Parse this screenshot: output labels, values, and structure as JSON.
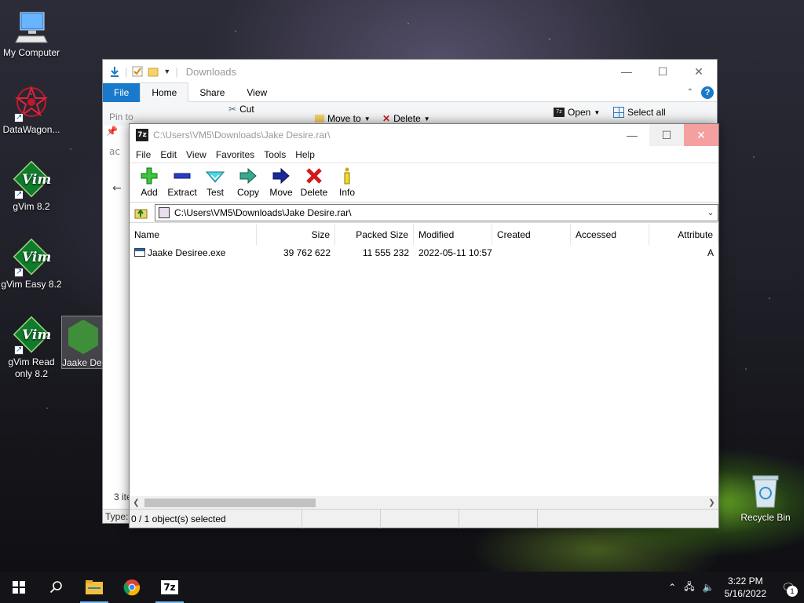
{
  "desktop": {
    "icons": [
      {
        "label": "My Computer"
      },
      {
        "label": "DataWagon..."
      },
      {
        "label": "gVim 8.2"
      },
      {
        "label": "gVim Easy 8.2"
      },
      {
        "label": "gVim Read only 8.2"
      },
      {
        "label": "Jaake Des"
      },
      {
        "label": "Recycle Bin"
      }
    ],
    "vim_mark": "Vim"
  },
  "explorer": {
    "title": "Downloads",
    "tabs": [
      "File",
      "Home",
      "Share",
      "View"
    ],
    "ribbon": {
      "cut": "Cut",
      "move_to": "Move to",
      "delete": "Delete",
      "open": "Open",
      "select_all": "Select all",
      "pin": "Pin to"
    },
    "pin_overflow": "ac",
    "help": "?",
    "items_count": "3 ite",
    "type_label": "Type:"
  },
  "sevenzip": {
    "title": "C:\\Users\\VM5\\Downloads\\Jake Desire.rar\\",
    "logo": "7z",
    "menu": [
      "File",
      "Edit",
      "View",
      "Favorites",
      "Tools",
      "Help"
    ],
    "toolbar": {
      "add": "Add",
      "extract": "Extract",
      "test": "Test",
      "copy": "Copy",
      "move": "Move",
      "delete": "Delete",
      "info": "Info"
    },
    "address": "C:\\Users\\VM5\\Downloads\\Jake Desire.rar\\",
    "columns": {
      "name": "Name",
      "size": "Size",
      "packed": "Packed Size",
      "modified": "Modified",
      "created": "Created",
      "accessed": "Accessed",
      "attributes": "Attribute"
    },
    "files": [
      {
        "name": "Jaake Desiree.exe",
        "size": "39 762 622",
        "packed": "11 555 232",
        "modified": "2022-05-11 10:57",
        "created": "",
        "accessed": "",
        "attributes": "A"
      }
    ],
    "status": "0 / 1 object(s) selected"
  },
  "taskbar": {
    "logo_7z": "7z",
    "time": "3:22 PM",
    "date": "5/16/2022",
    "notifications": "1"
  },
  "colors": {
    "accent": "#1979ca",
    "close_hover": "#f4a0a0",
    "taskbar": "#141418"
  }
}
